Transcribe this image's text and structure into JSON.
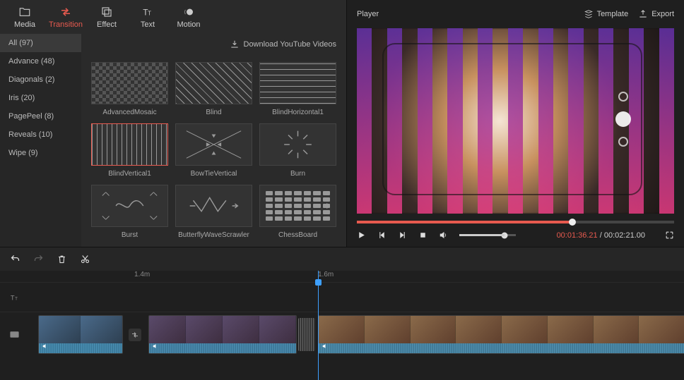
{
  "tabs": {
    "media": "Media",
    "transition": "Transition",
    "effect": "Effect",
    "text": "Text",
    "motion": "Motion"
  },
  "download_label": "Download YouTube Videos",
  "categories": [
    {
      "label": "All (97)"
    },
    {
      "label": "Advance (48)"
    },
    {
      "label": "Diagonals (2)"
    },
    {
      "label": "Iris (20)"
    },
    {
      "label": "PagePeel (8)"
    },
    {
      "label": "Reveals (10)"
    },
    {
      "label": "Wipe (9)"
    }
  ],
  "transitions": [
    {
      "name": "AdvancedMosaic"
    },
    {
      "name": "Blind"
    },
    {
      "name": "BlindHorizontal1"
    },
    {
      "name": "BlindVertical1"
    },
    {
      "name": "BowTieVertical"
    },
    {
      "name": "Burn"
    },
    {
      "name": "Burst"
    },
    {
      "name": "ButterflyWaveScrawler"
    },
    {
      "name": "ChessBoard"
    }
  ],
  "player": {
    "title": "Player",
    "template_btn": "Template",
    "export_btn": "Export",
    "current_time": "00:01:36.21",
    "total_time": "00:02:21.00"
  },
  "timeline": {
    "marks": [
      "1.4m",
      "1.6m"
    ]
  }
}
